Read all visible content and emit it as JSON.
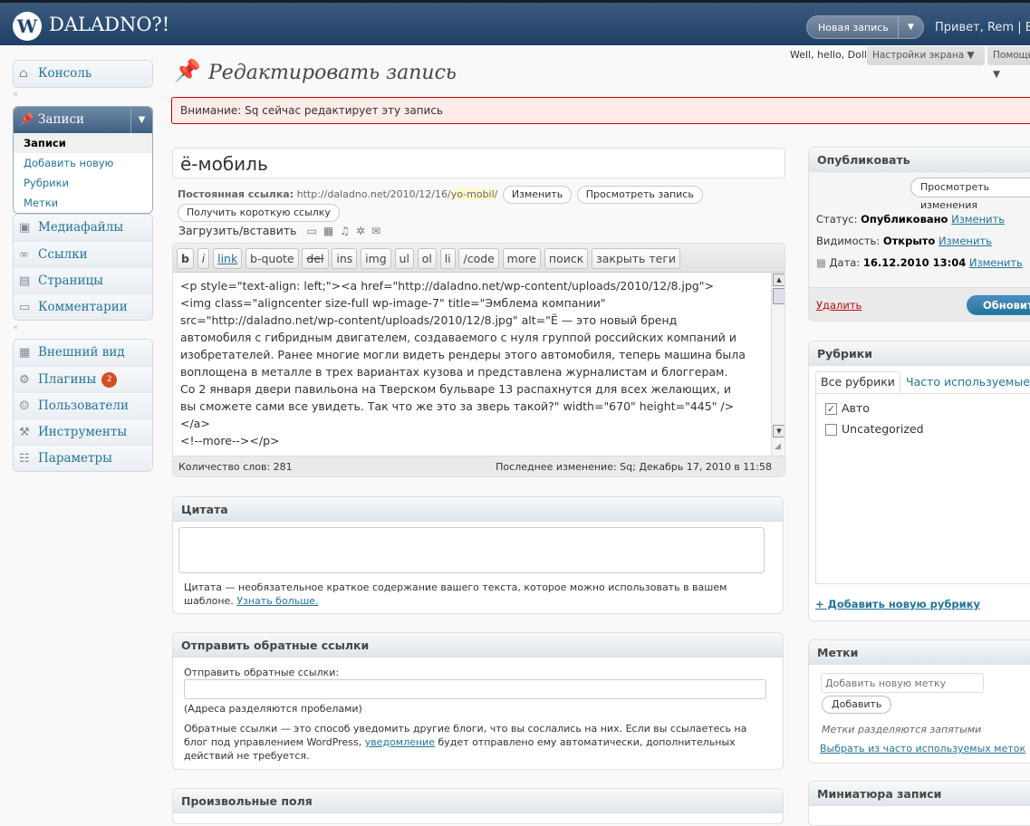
{
  "header": {
    "logo_glyph": "W",
    "site_title": "DALADNO?!",
    "new_post_label": "Новая запись",
    "new_post_arrow": "▼",
    "greeting": "Привет, Rem | Вы"
  },
  "sidebar": {
    "console": "Консоль",
    "posts": "Записи",
    "posts_sub": [
      "Записи",
      "Добавить новую",
      "Рубрики",
      "Метки"
    ],
    "media": "Медиафайлы",
    "links": "Ссылки",
    "pages": "Страницы",
    "comments": "Комментарии",
    "appearance": "Внешний вид",
    "plugins": "Плагины",
    "plugins_badge": "2",
    "users": "Пользователи",
    "tools": "Инструменты",
    "settings": "Параметры"
  },
  "top": {
    "hello": "Well, hello, Dolly",
    "screen_options": "Настройки экрана ▼",
    "help": "Помощь ▼"
  },
  "page_title": "Редактировать запись",
  "notice": "Внимание: Sq сейчас редактирует эту запись",
  "post_title": "ё-мобиль",
  "permalink": {
    "label": "Постоянная ссылка:",
    "url_prefix": "http://daladno.net/2010/12/16/",
    "slug": "yo-mobil",
    "url_suffix": "/",
    "edit_btn": "Изменить",
    "view_btn": "Просмотреть запись",
    "short_btn": "Получить короткую ссылку"
  },
  "upload_label": "Загрузить/вставить",
  "quicktags": [
    "b",
    "i",
    "link",
    "b-quote",
    "del",
    "ins",
    "img",
    "ul",
    "ol",
    "li",
    "/code",
    "more",
    "поиск",
    "закрыть теги"
  ],
  "content": "<p style=\"text-align: left;\"><a href=\"http://daladno.net/wp-content/uploads/2010/12/8.jpg\">\n<img class=\"aligncenter size-full wp-image-7\" title=\"Эмблема компании\"\nsrc=\"http://daladno.net/wp-content/uploads/2010/12/8.jpg\" alt=\"Ё — это новый бренд\nавтомобиля с гибридным двигателем, создаваемого с нуля группой российских компаний и\nизобретателей. Ранее многие могли видеть рендеры этого автомобиля, теперь машина была\nвоплощена в металле в трех вариантах кузова и представлена журналистам и блоггерам.\nСо 2 января двери павильона на Тверском бульваре 13 распахнутся для всех желающих, и\nвы сможете сами все увидеть. Так что же это за зверь такой?\" width=\"670\" height=\"445\" />\n</a>\n<!--more--></p>",
  "status": {
    "word_count": "Количество слов: 281",
    "last_edit": "Последнее изменение: Sq; Декабрь 17, 2010 в 11:58"
  },
  "excerpt": {
    "title": "Цитата",
    "help": "Цитата — необязательное краткое содержание вашего текста, которое можно использовать в вашем шаблоне.",
    "learn_more": "Узнать больше."
  },
  "trackbacks": {
    "title": "Отправить обратные ссылки",
    "label": "Отправить обратные ссылки:",
    "hint": "(Адреса разделяются пробелами)",
    "help_a": "Обратные ссылки — это способ уведомить другие блоги, что вы сослались на них. Если вы ссылаетесь на блог под управлением WordPress,",
    "help_link": "уведомление",
    "help_b": "будет отправлено ему автоматически, дополнительных действий не требуется."
  },
  "custom_fields": {
    "title": "Произвольные поля"
  },
  "publish": {
    "title": "Опубликовать",
    "preview_btn": "Просмотреть изменения",
    "status_label": "Статус:",
    "status_value": "Опубликовано",
    "visibility_label": "Видимость:",
    "visibility_value": "Открыто",
    "date_label": "Дата:",
    "date_value": "16.12.2010 13:04",
    "change": "Изменить",
    "delete": "Удалить",
    "update_btn": "Обновить"
  },
  "categories": {
    "title": "Рубрики",
    "tab_all": "Все рубрики",
    "tab_popular": "Часто используемые",
    "items": [
      {
        "label": "Авто",
        "checked": "✓"
      },
      {
        "label": "Uncategorized",
        "checked": ""
      }
    ],
    "add_new": "+ Добавить новую рубрику"
  },
  "tags": {
    "title": "Метки",
    "placeholder": "Добавить новую метку",
    "add_btn": "Добавить",
    "hint": "Метки разделяются запятыми",
    "choose": "Выбрать из часто используемых меток"
  },
  "thumbnail": {
    "title": "Миниатюра записи"
  }
}
